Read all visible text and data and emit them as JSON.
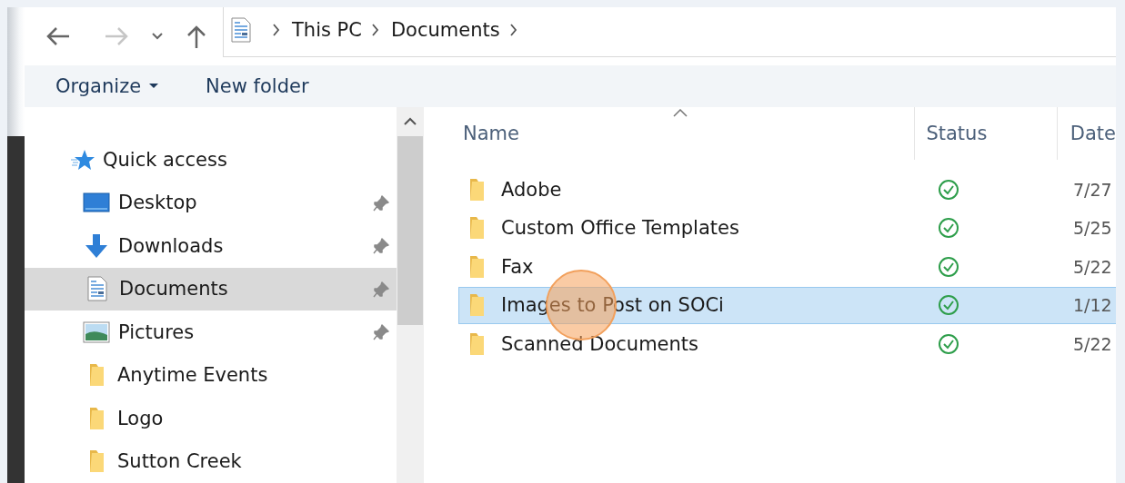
{
  "navigation": {
    "back": {
      "disabled": false
    },
    "forward": {
      "disabled": true
    }
  },
  "address_bar": {
    "crumbs": [
      "This PC",
      "Documents"
    ]
  },
  "toolbar": {
    "buttons": [
      {
        "label": "Organize",
        "dropdown": true
      },
      {
        "label": "New folder",
        "dropdown": false
      }
    ]
  },
  "sidebar": {
    "items": [
      {
        "label": "Quick access",
        "kind": "star",
        "selected": false,
        "children": [
          {
            "label": "Desktop",
            "kind": "desktop",
            "pinned": true,
            "selected": false
          },
          {
            "label": "Downloads",
            "kind": "download",
            "pinned": true,
            "selected": false
          },
          {
            "label": "Documents",
            "kind": "document",
            "pinned": true,
            "selected": true
          },
          {
            "label": "Pictures",
            "kind": "picture",
            "pinned": true,
            "selected": false
          },
          {
            "label": "Anytime Events",
            "kind": "folder",
            "pinned": false,
            "selected": false
          },
          {
            "label": "Logo",
            "kind": "folder",
            "pinned": false,
            "selected": false
          },
          {
            "label": "Sutton Creek",
            "kind": "folder",
            "pinned": false,
            "selected": false
          }
        ]
      }
    ]
  },
  "file_list": {
    "columns": [
      {
        "label": "Name",
        "sorted": true
      },
      {
        "label": "Status",
        "sorted": false
      },
      {
        "label": "Date",
        "sorted": false
      }
    ],
    "rows": [
      {
        "name": "Adobe",
        "synced": true,
        "date": "7/27",
        "selected": false
      },
      {
        "name": "Custom Office Templates",
        "synced": true,
        "date": "5/25",
        "selected": false
      },
      {
        "name": "Fax",
        "synced": true,
        "date": "5/22",
        "selected": false
      },
      {
        "name": "Images to Post on SOCi",
        "synced": true,
        "date": "1/12",
        "selected": true
      },
      {
        "name": "Scanned Documents",
        "synced": true,
        "date": "5/22",
        "selected": false
      }
    ]
  }
}
